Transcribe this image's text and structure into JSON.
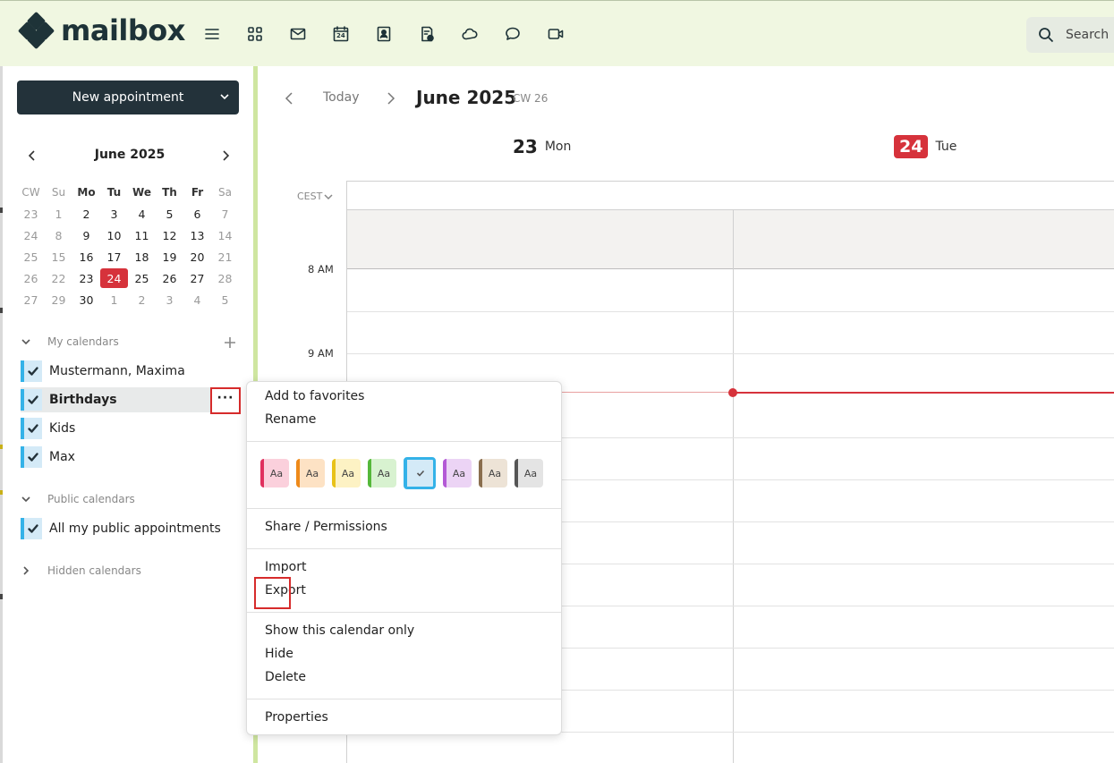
{
  "app": {
    "logo_text": "mailbox",
    "search_placeholder": "Search"
  },
  "topbar": {
    "icons": [
      "menu-icon",
      "apps-grid-icon",
      "mail-icon",
      "calendar-icon",
      "contacts-icon",
      "tasks-icon",
      "cloud-icon",
      "chat-icon",
      "video-icon"
    ],
    "calendar_icon_text": "24"
  },
  "sidebar": {
    "new_appointment": "New appointment",
    "mini_calendar": {
      "title": "June 2025",
      "headers": [
        "CW",
        "Su",
        "Mo",
        "Tu",
        "We",
        "Th",
        "Fr",
        "Sa"
      ],
      "rows": [
        [
          "23",
          "1",
          "2",
          "3",
          "4",
          "5",
          "6",
          "7"
        ],
        [
          "24",
          "8",
          "9",
          "10",
          "11",
          "12",
          "13",
          "14"
        ],
        [
          "25",
          "15",
          "16",
          "17",
          "18",
          "19",
          "20",
          "21"
        ],
        [
          "26",
          "22",
          "23",
          "24",
          "25",
          "26",
          "27",
          "28"
        ],
        [
          "27",
          "29",
          "30",
          "1",
          "2",
          "3",
          "4",
          "5"
        ]
      ],
      "today": "24"
    },
    "my_calendars_label": "My calendars",
    "my_calendars": [
      "Mustermann, Maxima",
      "Birthdays",
      "Kids",
      "Max"
    ],
    "public_calendars_label": "Public calendars",
    "public_calendars": [
      "All my public appointments"
    ],
    "hidden_calendars_label": "Hidden calendars",
    "more_button": "···"
  },
  "main": {
    "today_label": "Today",
    "title": "June 2025",
    "cw": "CW 26",
    "days": [
      {
        "num": "23",
        "name": "Mon"
      },
      {
        "num": "24",
        "name": "Tue"
      }
    ],
    "timezone": "CEST",
    "times": [
      "8 AM",
      "9 AM"
    ]
  },
  "context_menu": {
    "add_favorites": "Add to favorites",
    "rename": "Rename",
    "swatch_label": "Aa",
    "swatch_colors": [
      {
        "bg": "#fbd0dc",
        "edge": "#e0305e"
      },
      {
        "bg": "#fde2c4",
        "edge": "#ee8a1a"
      },
      {
        "bg": "#fdf2c4",
        "edge": "#e8c21a"
      },
      {
        "bg": "#d8f2d0",
        "edge": "#55b83a"
      },
      {
        "bg": "#d4eaf7",
        "edge": "#34b2e8"
      },
      {
        "bg": "#ecd4f5",
        "edge": "#b45ad6"
      },
      {
        "bg": "#ede3d6",
        "edge": "#8a6e4e"
      },
      {
        "bg": "#e4e4e4",
        "edge": "#555555"
      }
    ],
    "share": "Share / Permissions",
    "import": "Import",
    "export": "Export",
    "show_only": "Show this calendar only",
    "hide": "Hide",
    "delete": "Delete",
    "properties": "Properties"
  }
}
